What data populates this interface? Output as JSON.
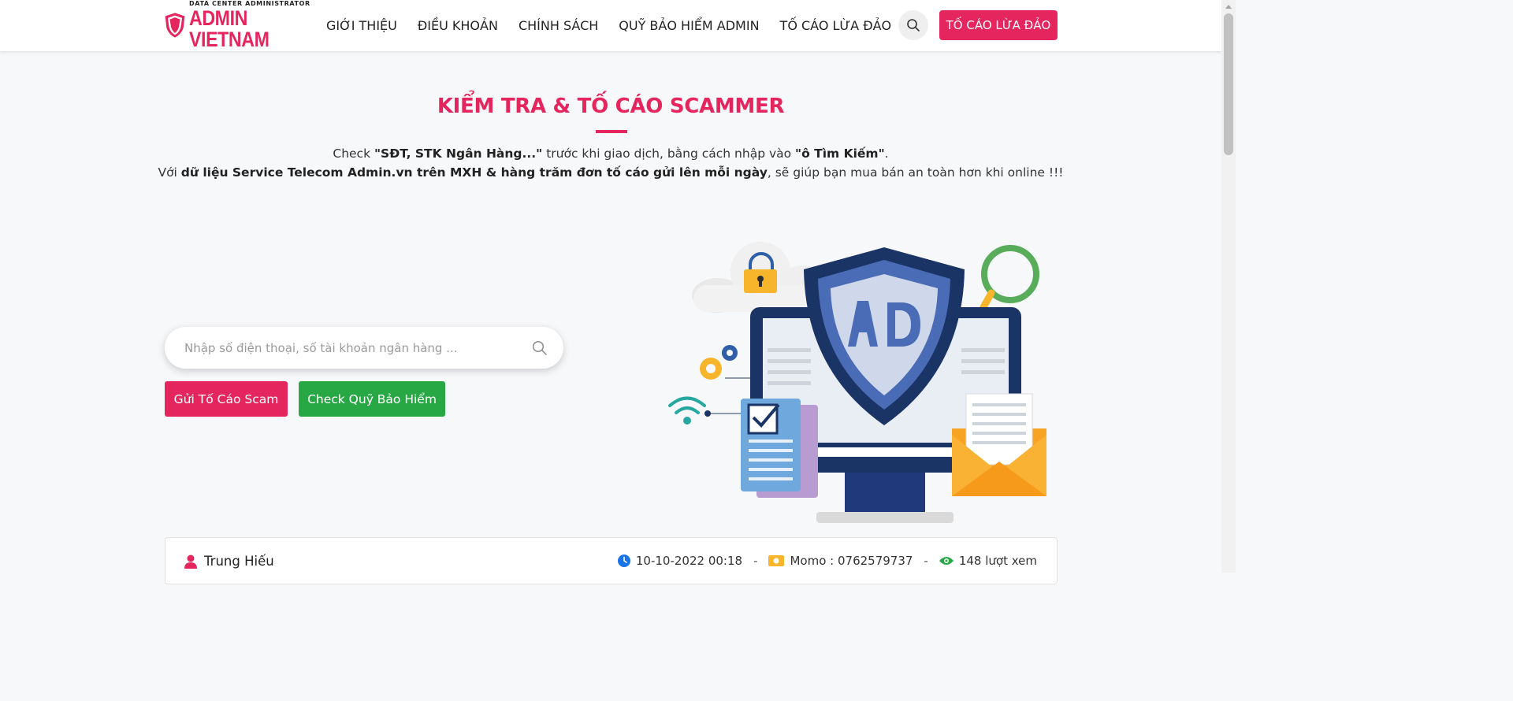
{
  "header": {
    "logo": {
      "tagline": "DATA CENTER ADMINISTRATOR",
      "brand": "ADMIN VIETNAM",
      "shield_text": "AD"
    },
    "nav": [
      {
        "label": "GIỚI THIỆU"
      },
      {
        "label": "ĐIỀU KHOẢN"
      },
      {
        "label": "CHÍNH SÁCH"
      },
      {
        "label": "QUỸ BẢO HIỂM ADMIN"
      },
      {
        "label": "TỐ CÁO LỪA ĐẢO"
      }
    ],
    "search_icon": "search-icon",
    "report_button": "TỐ CÁO LỪA ĐẢO"
  },
  "hero": {
    "title": "KIỂM TRA & TỐ CÁO SCAMMER",
    "line1": {
      "prefix": "Check ",
      "bold1": "\"SĐT, STK Ngân Hàng...\"",
      "middle": " trước khi giao dịch, bằng cách nhập vào ",
      "bold2": "\"ô Tìm Kiếm\"",
      "suffix": "."
    },
    "line2": {
      "prefix": "Với ",
      "bold": "dữ liệu Service Telecom Admin.vn trên MXH & hàng trăm đơn tố cáo gửi lên mỗi ngày",
      "suffix": ", sẽ giúp bạn mua bán an toàn hơn khi online !!!"
    },
    "search": {
      "placeholder": "Nhập số điện thoại, số tài khoản ngân hàng ...",
      "value": ""
    },
    "report_scam_button": "Gửi Tố Cáo Scam",
    "check_insurance_button": "Check Quỹ Bảo Hiểm"
  },
  "post": {
    "user": "Trung Hiếu",
    "datetime": "10-10-2022 00:18",
    "account": "Momo : 0762579737",
    "views": "148 lượt xem",
    "separator": "-"
  },
  "colors": {
    "brand": "#e5255d",
    "green": "#28a745",
    "navy": "#1b3466",
    "shield_blue": "#4a6bb5"
  }
}
